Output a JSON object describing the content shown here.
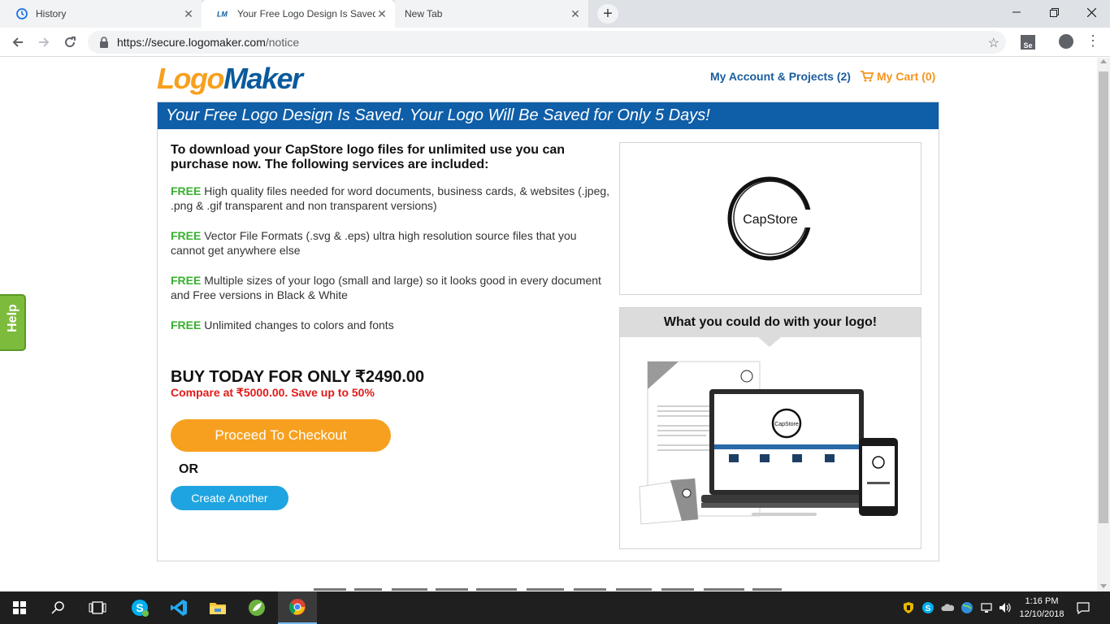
{
  "browser": {
    "tabs": [
      {
        "title": "History",
        "icon": "history-icon"
      },
      {
        "title": "Your Free Logo Design Is Saved. Y",
        "icon": "logomaker-favicon"
      },
      {
        "title": "New Tab",
        "icon": "none"
      }
    ],
    "new_tab_label": "+",
    "url_host": "https://secure.logomaker.com",
    "url_path": "/notice",
    "extension_label": "Se"
  },
  "header": {
    "logo_part_a": "Logo",
    "logo_part_b": "Maker",
    "my_account_label": "My Account & Projects (2)",
    "cart_label": "My Cart (0)"
  },
  "banner": {
    "text": "Your Free Logo Design Is Saved. Your Logo Will Be Saved for Only 5 Days!"
  },
  "content": {
    "intro": "To download your CapStore logo files for unlimited use you can purchase now. The following services are included:",
    "free_tag": "FREE",
    "features": [
      "High quality files needed for word documents, business cards, & websites (.jpeg, .png & .gif transparent and non transparent versions)",
      "Vector File Formats (.svg & .eps) ultra high resolution source files that you cannot get anywhere else",
      "Multiple sizes of your logo (small and large) so it looks good in every document and Free versions in Black & White",
      "Unlimited changes to colors and fonts"
    ],
    "buy_today": "BUY TODAY FOR ONLY ₹2490.00",
    "compare": "Compare at ₹5000.00. Save up to 50%",
    "checkout_label": "Proceed To Checkout",
    "or_label": "OR",
    "create_another_label": "Create Another"
  },
  "preview": {
    "logo_text": "CapStore"
  },
  "usage": {
    "heading": "What you could do with your logo!",
    "mock_logo_text": "CapStore"
  },
  "help": {
    "label": "Help"
  },
  "taskbar": {
    "time": "1:16 PM",
    "date": "12/10/2018"
  },
  "colors": {
    "brand_orange": "#f7a01f",
    "brand_blue": "#0f5ea8",
    "free_green": "#37b02f",
    "compare_red": "#e11b1b",
    "create_blue": "#1ea4e0",
    "help_green": "#7dbb3c"
  }
}
